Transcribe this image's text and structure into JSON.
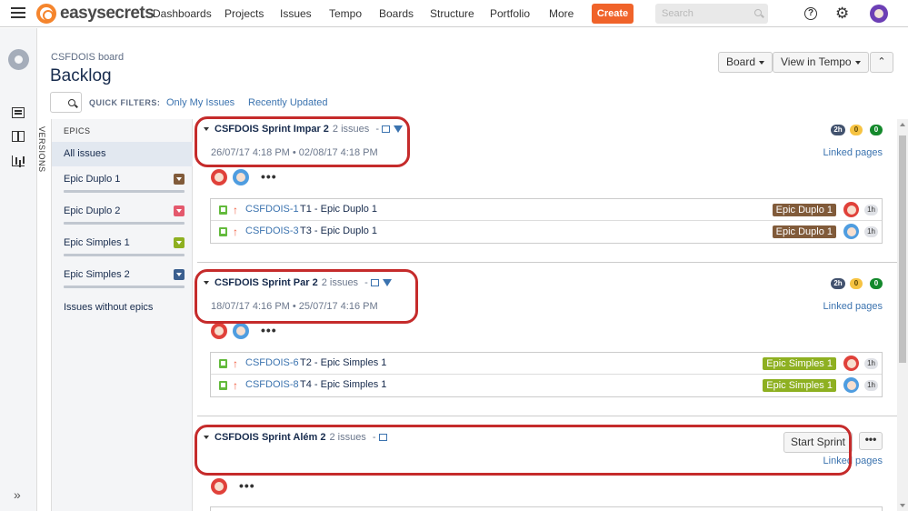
{
  "nav": {
    "brand": "easysecrets",
    "items": [
      "Dashboards",
      "Projects",
      "Issues",
      "Tempo",
      "Boards",
      "Structure",
      "Portfolio",
      "More"
    ],
    "create_label": "Create",
    "search_placeholder": "Search",
    "help_glyph": "?",
    "gear_glyph": "⚙"
  },
  "header": {
    "board_name": "CSFDOIS board",
    "title": "Backlog",
    "board_button": "Board",
    "view_tempo_button": "View in Tempo",
    "collapse_glyph": "⌃"
  },
  "quick_filters": {
    "label": "QUICK FILTERS:",
    "filters": [
      "Only My Issues",
      "Recently Updated"
    ]
  },
  "versions_label": "VERSIONS",
  "epics_panel": {
    "title": "EPICS",
    "all_label": "All issues",
    "items": [
      {
        "name": "Epic Duplo 1",
        "color": "#815b3a"
      },
      {
        "name": "Epic Duplo 2",
        "color": "#e4596d"
      },
      {
        "name": "Epic Simples 1",
        "color": "#8eb021"
      },
      {
        "name": "Epic Simples 2",
        "color": "#3b5f8f"
      }
    ],
    "without_epics": "Issues without epics"
  },
  "sprints": [
    {
      "name": "CSFDOIS Sprint Impar 2",
      "issue_count": "2 issues",
      "dates": "26/07/17 4:18 PM  •  02/08/17 4:18 PM",
      "linked": "Linked pages",
      "stats": [
        "2h",
        "0",
        "0"
      ],
      "more": "•••",
      "issues": [
        {
          "key": "CSFDOIS-1",
          "summary": "T1 - Epic Duplo 1",
          "epic": "Epic Duplo 1",
          "epic_color": "#815b3a",
          "estimate": "1h"
        },
        {
          "key": "CSFDOIS-3",
          "summary": "T3 - Epic Duplo 1",
          "epic": "Epic Duplo 1",
          "epic_color": "#815b3a",
          "estimate": "1h"
        }
      ]
    },
    {
      "name": "CSFDOIS Sprint Par 2",
      "issue_count": "2 issues",
      "dates": "18/07/17 4:16 PM  •  25/07/17 4:16 PM",
      "linked": "Linked pages",
      "stats": [
        "2h",
        "0",
        "0"
      ],
      "more": "•••",
      "issues": [
        {
          "key": "CSFDOIS-6",
          "summary": "T2 - Epic Simples 1",
          "epic": "Epic Simples 1",
          "epic_color": "#8eb021",
          "estimate": "1h"
        },
        {
          "key": "CSFDOIS-8",
          "summary": "T4 - Epic Simples 1",
          "epic": "Epic Simples 1",
          "epic_color": "#8eb021",
          "estimate": "1h"
        }
      ]
    },
    {
      "name": "CSFDOIS Sprint Além 2",
      "issue_count": "2 issues",
      "linked": "Linked pages",
      "start_label": "Start Sprint",
      "more": "•••"
    }
  ],
  "colors": {
    "annotation": "#c52b2b",
    "link": "#3b73af",
    "create": "#f0632a"
  }
}
